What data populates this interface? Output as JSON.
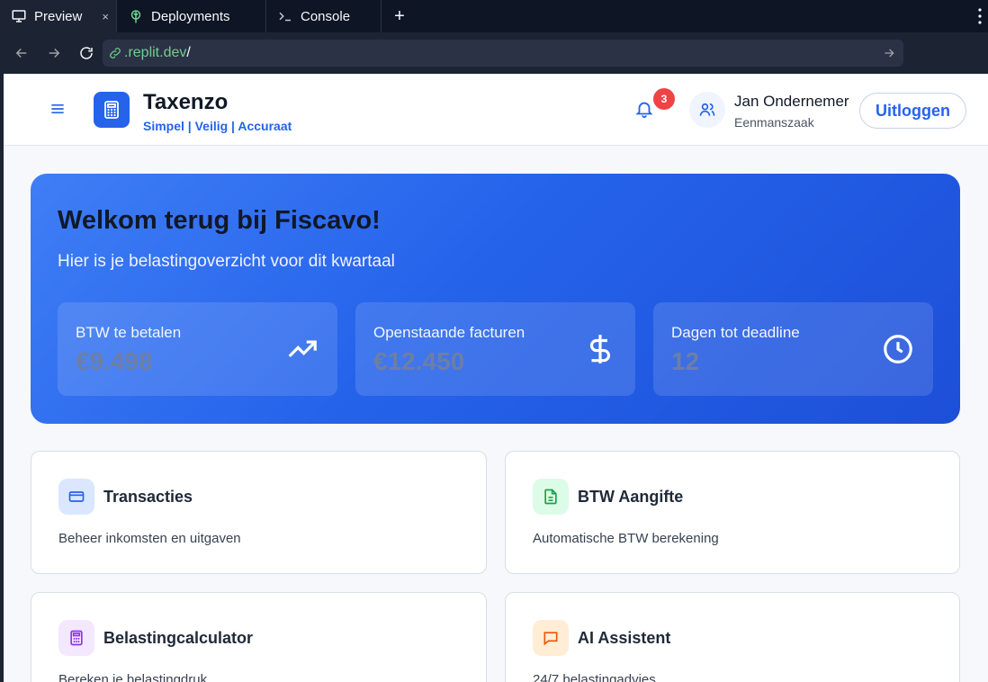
{
  "browser": {
    "tabs": [
      {
        "label": "Preview",
        "icon": "monitor-icon",
        "close": "×"
      },
      {
        "label": "Deployments",
        "icon": "deployments-icon"
      },
      {
        "label": "Console",
        "icon": "terminal-icon"
      }
    ],
    "new_tab": "+",
    "url_domain": ".replit.dev",
    "url_path": "/"
  },
  "header": {
    "brand_name": "Taxenzo",
    "brand_tagline": "Simpel | Veilig | Accuraat",
    "notification_count": "3",
    "user_name": "Jan Ondernemer",
    "user_role": "Eenmanszaak",
    "logout_label": "Uitloggen"
  },
  "hero": {
    "title": "Welkom terug bij Fiscavo!",
    "subtitle": "Hier is je belastingoverzicht voor dit kwartaal",
    "stats": [
      {
        "label": "BTW te betalen",
        "value": "€9.498",
        "icon": "trending-up-icon"
      },
      {
        "label": "Openstaande facturen",
        "value": "€12.450",
        "icon": "dollar-icon"
      },
      {
        "label": "Dagen tot deadline",
        "value": "12",
        "icon": "clock-icon"
      }
    ]
  },
  "cards": [
    {
      "title": "Transacties",
      "description": "Beheer inkomsten en uitgaven",
      "icon": "credit-card-icon",
      "accent": "#2563eb",
      "bg": "#dbe7fe"
    },
    {
      "title": "BTW Aangifte",
      "description": "Automatische BTW berekening",
      "icon": "file-text-icon",
      "accent": "#16a34a",
      "bg": "#dcfce7"
    },
    {
      "title": "Belastingcalculator",
      "description": "Bereken je belastingdruk",
      "icon": "calculator-icon",
      "accent": "#9333ea",
      "bg": "#f3e8ff"
    },
    {
      "title": "AI Assistent",
      "description": "24/7 belastingadvies",
      "icon": "message-icon",
      "accent": "#ea580c",
      "bg": "#ffedd5"
    }
  ],
  "colors": {
    "primary": "#2563eb",
    "badge": "#ef4444",
    "chrome_bg": "#0e1525"
  }
}
